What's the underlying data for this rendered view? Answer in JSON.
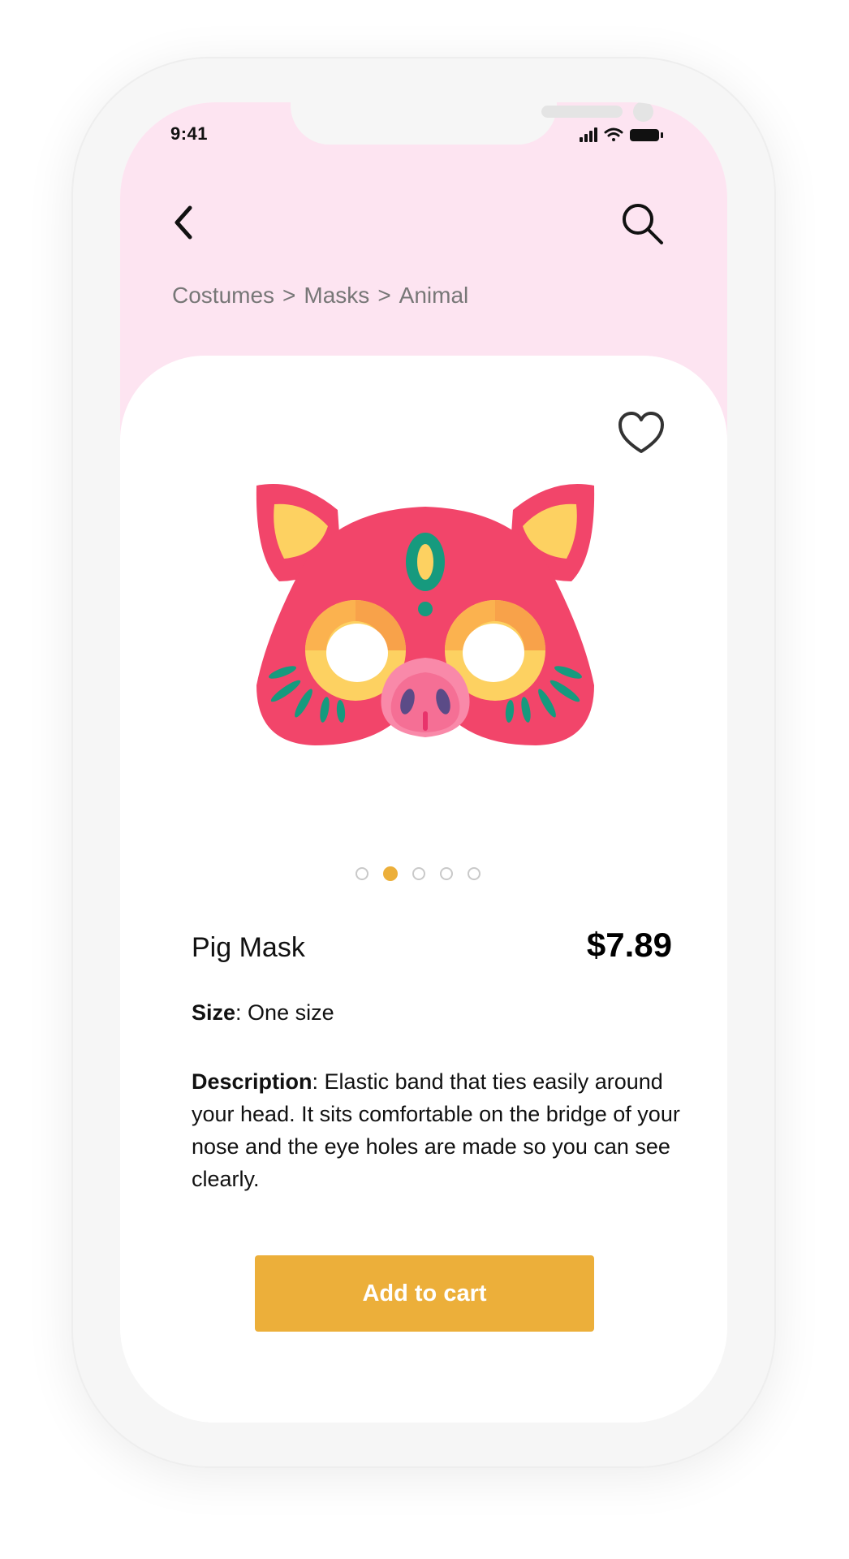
{
  "status_bar": {
    "time": "9:41"
  },
  "nav": {
    "back_icon": "chevron-left-icon",
    "search_icon": "search-icon"
  },
  "breadcrumb": {
    "items": [
      "Costumes",
      "Masks",
      "Animal"
    ],
    "separator": ">"
  },
  "product": {
    "name": "Pig Mask",
    "price": "$7.89",
    "size_label": "Size",
    "size_value": "One size",
    "description_label": "Description",
    "description_value": "Elastic band that ties easily around your head. It sits comfortable on the bridge of your nose and the eye holes are made so you can see clearly.",
    "favorite_icon": "heart-outline-icon"
  },
  "gallery": {
    "image_count": 5,
    "active_index": 1
  },
  "actions": {
    "add_to_cart_label": "Add to cart"
  },
  "colors": {
    "header_background": "#fde4f1",
    "accent": "#ecaf3a",
    "mask_red": "#f2456a",
    "mask_yellow": "#fdd161",
    "mask_teal": "#169a7e",
    "mask_pink": "#f989a9"
  }
}
